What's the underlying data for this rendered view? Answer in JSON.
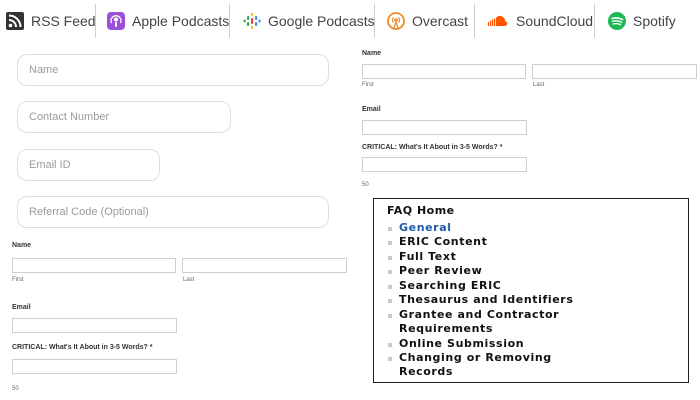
{
  "podcast_bar": {
    "items": [
      {
        "label": "RSS Feed",
        "icon": "rss-icon",
        "color": "#333333"
      },
      {
        "label": "Apple Podcasts",
        "icon": "apple-podcasts-icon",
        "color": "#9b4fd6"
      },
      {
        "label": "Google Podcasts",
        "icon": "google-podcasts-icon",
        "color": "#4285f4"
      },
      {
        "label": "Overcast",
        "icon": "overcast-icon",
        "color": "#f08a24"
      },
      {
        "label": "SoundCloud",
        "icon": "soundcloud-icon",
        "color": "#ff5500"
      },
      {
        "label": "Spotify",
        "icon": "spotify-icon",
        "color": "#1db954"
      }
    ]
  },
  "signup_form": {
    "name_placeholder": "Name",
    "contact_placeholder": "Contact Number",
    "email_placeholder": "Email ID",
    "referral_placeholder": "Referral Code (Optional)"
  },
  "form_a": {
    "name_label": "Name",
    "first_label": "First",
    "last_label": "Last",
    "email_label": "Email",
    "critical_label": "CRITICAL: What's It About in 3-5 Words? *",
    "char_count": "50"
  },
  "form_b": {
    "name_label": "Name",
    "first_label": "First",
    "last_label": "Last",
    "email_label": "Email",
    "critical_label": "CRITICAL: What's It About in 3-5 Words? *",
    "char_count": "50"
  },
  "faq": {
    "title": "FAQ Home",
    "items": [
      "General",
      "ERIC Content",
      "Full Text",
      "Peer Review",
      "Searching ERIC",
      "Thesaurus and Identifiers",
      "Grantee and Contractor",
      "Requirements",
      "Online Submission",
      "Changing or Removing",
      "Records"
    ],
    "active_index": 0,
    "active_color": "#1f5aa6"
  }
}
